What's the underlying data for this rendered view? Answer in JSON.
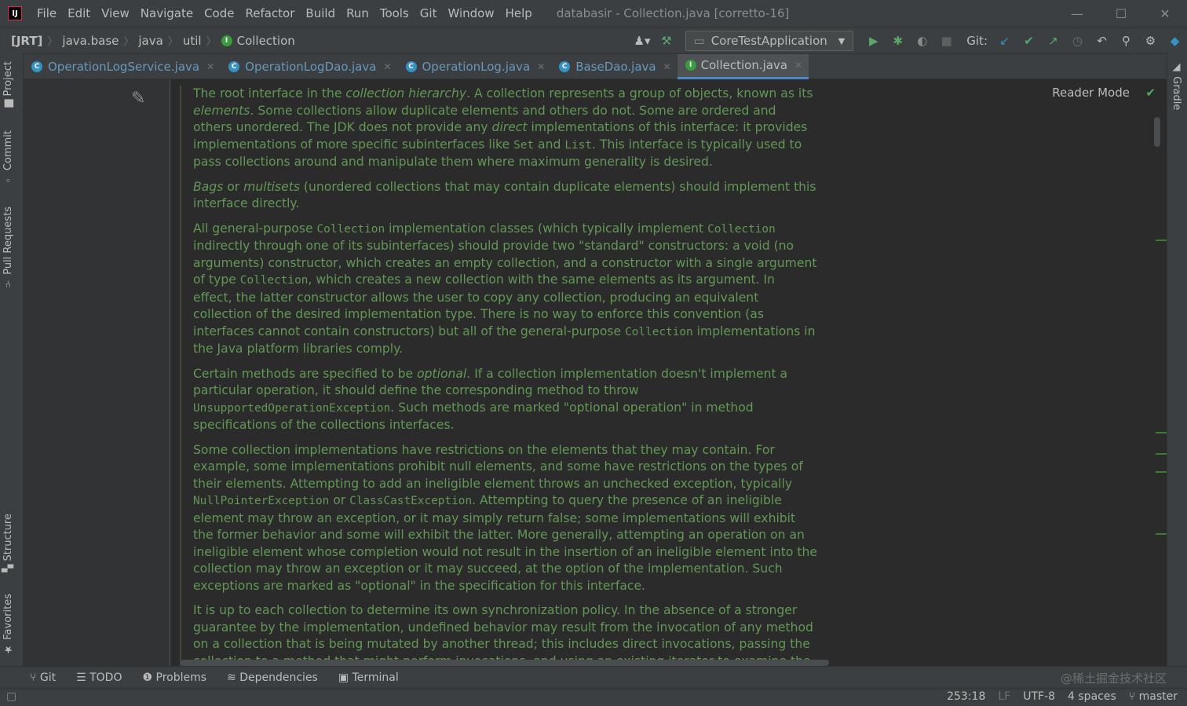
{
  "window": {
    "title": "databasir - Collection.java [corretto-16]",
    "controls": {
      "minimize": "—",
      "maximize": "☐",
      "close": "✕"
    }
  },
  "menu": [
    "File",
    "Edit",
    "View",
    "Navigate",
    "Code",
    "Refactor",
    "Build",
    "Run",
    "Tools",
    "Git",
    "Window",
    "Help"
  ],
  "breadcrumb": [
    "[JRT]",
    "java.base",
    "java",
    "util",
    "Collection"
  ],
  "run_config": "CoreTestApplication",
  "git_label": "Git:",
  "tabs": [
    {
      "label": "OperationLogService.java",
      "active": false
    },
    {
      "label": "OperationLogDao.java",
      "active": false
    },
    {
      "label": "OperationLog.java",
      "active": false
    },
    {
      "label": "BaseDao.java",
      "active": false
    },
    {
      "label": "Collection.java",
      "active": true
    }
  ],
  "left_tools": [
    "Project",
    "Commit",
    "Pull Requests",
    "Structure",
    "Favorites"
  ],
  "right_tools": [
    "Gradle"
  ],
  "reader_mode": "Reader Mode",
  "doc": {
    "p1": {
      "a": "The root interface in the ",
      "b": "collection hierarchy",
      "c": ". A collection represents a group of objects, known as its ",
      "d": "elements",
      "e": ". Some collections allow duplicate elements and others do not. Some are ordered and others unordered. The JDK does not provide any ",
      "f": "direct",
      "g": " implementations of this interface: it provides implementations of more specific subinterfaces like ",
      "h": "Set",
      "i": " and ",
      "j": "List",
      "k": ". This interface is typically used to pass collections around and manipulate them where maximum generality is desired."
    },
    "p2": {
      "a": "Bags",
      "b": " or ",
      "c": "multisets",
      "d": " (unordered collections that may contain duplicate elements) should implement this interface directly."
    },
    "p3": {
      "a": "All general-purpose ",
      "b": "Collection",
      "c": " implementation classes (which typically implement ",
      "d": "Collection",
      "e": " indirectly through one of its subinterfaces) should provide two \"standard\" constructors: a void (no arguments) constructor, which creates an empty collection, and a constructor with a single argument of type ",
      "f": "Collection",
      "g": ", which creates a new collection with the same elements as its argument. In effect, the latter constructor allows the user to copy any collection, producing an equivalent collection of the desired implementation type. There is no way to enforce this convention (as interfaces cannot contain constructors) but all of the general-purpose ",
      "h": "Collection",
      "i": " implementations in the Java platform libraries comply."
    },
    "p4": {
      "a": "Certain methods are specified to be ",
      "b": "optional",
      "c": ". If a collection implementation doesn't implement a particular operation, it should define the corresponding method to throw ",
      "d": "UnsupportedOperationException",
      "e": ". Such methods are marked \"optional operation\" in method specifications of the collections interfaces."
    },
    "p5": {
      "a": "Some collection implementations have restrictions on the elements that they may contain. For example, some implementations prohibit null elements, and some have restrictions on the types of their elements. Attempting to add an ineligible element throws an unchecked exception, typically ",
      "b": "NullPointerException",
      "c": " or ",
      "d": "ClassCastException",
      "e": ". Attempting to query the presence of an ineligible element may throw an exception, or it may simply return false; some implementations will exhibit the former behavior and some will exhibit the latter. More generally, attempting an operation on an ineligible element whose completion would not result in the insertion of an ineligible element into the collection may throw an exception or it may succeed, at the option of the implementation. Such exceptions are marked as \"optional\" in the specification for this interface."
    },
    "p6": "It is up to each collection to determine its own synchronization policy. In the absence of a stronger guarantee by the implementation, undefined behavior may result from the invocation of any method on a collection that is being mutated by another thread; this includes direct invocations, passing the collection to a method that might perform invocations, and using an existing iterator to examine the"
  },
  "bottom_tools": [
    "Git",
    "TODO",
    "Problems",
    "Dependencies",
    "Terminal"
  ],
  "watermark": "@稀土掘金技术社区",
  "status": {
    "position": "253:18",
    "line_sep": "LF",
    "encoding": "UTF-8",
    "indent": "4 spaces",
    "branch": "master"
  }
}
